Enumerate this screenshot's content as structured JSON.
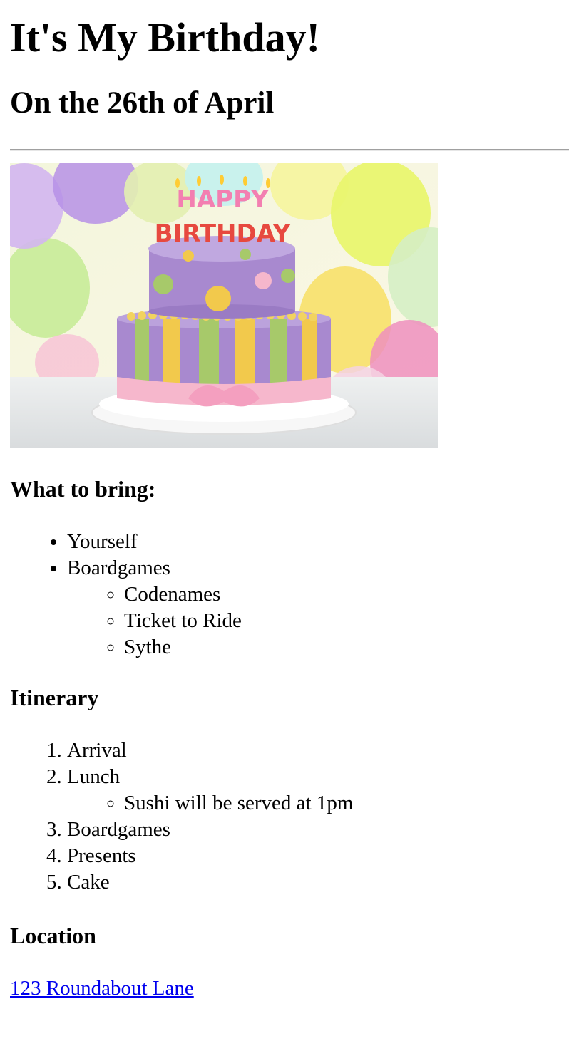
{
  "page": {
    "title": "It's My Birthday!",
    "subtitle": "On the 26th of April"
  },
  "image": {
    "cake_text_line1": "HAPPY",
    "cake_text_line2": "BIRTHDAY"
  },
  "bring": {
    "heading": "What to bring:",
    "items": [
      "Yourself",
      "Boardgames"
    ],
    "boardgames": [
      "Codenames",
      "Ticket to Ride",
      "Sythe"
    ]
  },
  "itinerary": {
    "heading": "Itinerary",
    "items": [
      "Arrival",
      "Lunch",
      "Boardgames",
      "Presents",
      "Cake"
    ],
    "lunch_note": "Sushi will be served at 1pm"
  },
  "location": {
    "heading": "Location",
    "address": "123 Roundabout Lane"
  },
  "colors": {
    "link": "#0000ee",
    "cake_purple": "#a889cf",
    "cake_yellow": "#f2c94c",
    "cake_green": "#a7c96a",
    "ribbon_pink": "#f6b7cc"
  }
}
